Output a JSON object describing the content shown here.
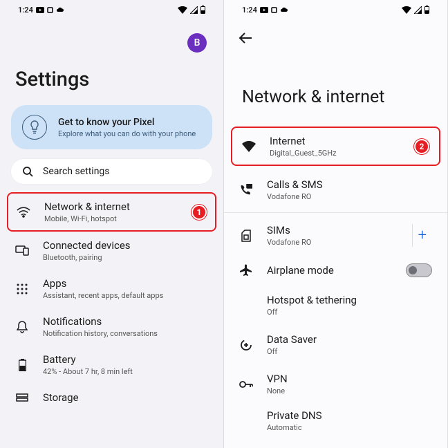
{
  "statusbar": {
    "time": "1:24"
  },
  "screen1": {
    "avatar_letter": "B",
    "title": "Settings",
    "tip": {
      "title": "Get to know your Pixel",
      "subtitle": "Explore what you can do with your phone"
    },
    "search_placeholder": "Search settings",
    "items": [
      {
        "title": "Network & internet",
        "sub": "Mobile, Wi-Fi, hotspot",
        "badge": "1"
      },
      {
        "title": "Connected devices",
        "sub": "Bluetooth, pairing"
      },
      {
        "title": "Apps",
        "sub": "Assistant, recent apps, default apps"
      },
      {
        "title": "Notifications",
        "sub": "Notification history, conversations"
      },
      {
        "title": "Battery",
        "sub": "42% - About 7 hr, 8 min left"
      },
      {
        "title": "Storage",
        "sub": ""
      }
    ]
  },
  "screen2": {
    "title": "Network & internet",
    "items": [
      {
        "title": "Internet",
        "sub": "Digital_Guest_5GHz",
        "badge": "2"
      },
      {
        "title": "Calls & SMS",
        "sub": "Vodafone RO"
      },
      {
        "title": "SIMs",
        "sub": "Vodafone RO",
        "plus": true
      },
      {
        "title": "Airplane mode",
        "toggle": true
      },
      {
        "title": "Hotspot & tethering",
        "sub": "Off"
      },
      {
        "title": "Data Saver",
        "sub": "Off"
      },
      {
        "title": "VPN",
        "sub": "None"
      }
    ],
    "private_dns": {
      "title": "Private DNS",
      "sub": "Automatic"
    }
  }
}
